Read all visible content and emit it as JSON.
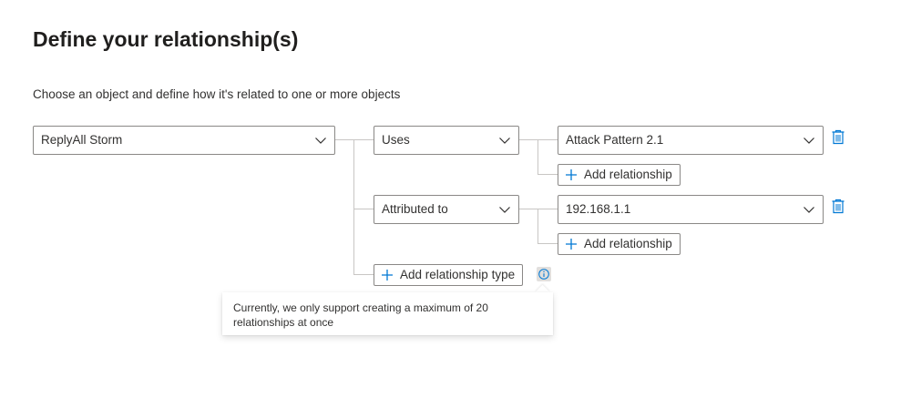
{
  "page": {
    "title": "Define your relationship(s)",
    "subtitle": "Choose an object and define how it's related to one or more objects"
  },
  "source_object": {
    "selected": "ReplyAll Storm"
  },
  "relationships": [
    {
      "type": "Uses",
      "target": "Attack Pattern 2.1",
      "add_relationship_label": "Add relationship"
    },
    {
      "type": "Attributed to",
      "target": "192.168.1.1",
      "add_relationship_label": "Add relationship"
    }
  ],
  "add_relationship_type_label": "Add relationship type",
  "tooltip": {
    "text": "Currently, we only support creating a maximum of 20 relationships at once"
  },
  "icons": {
    "dropdown": "chevron-down-icon",
    "add": "plus-icon",
    "delete": "trash-icon",
    "info": "info-icon"
  },
  "colors": {
    "accent": "#0078d4",
    "border": "#8a8886",
    "connector": "#c8c6c4",
    "text": "#323130"
  }
}
